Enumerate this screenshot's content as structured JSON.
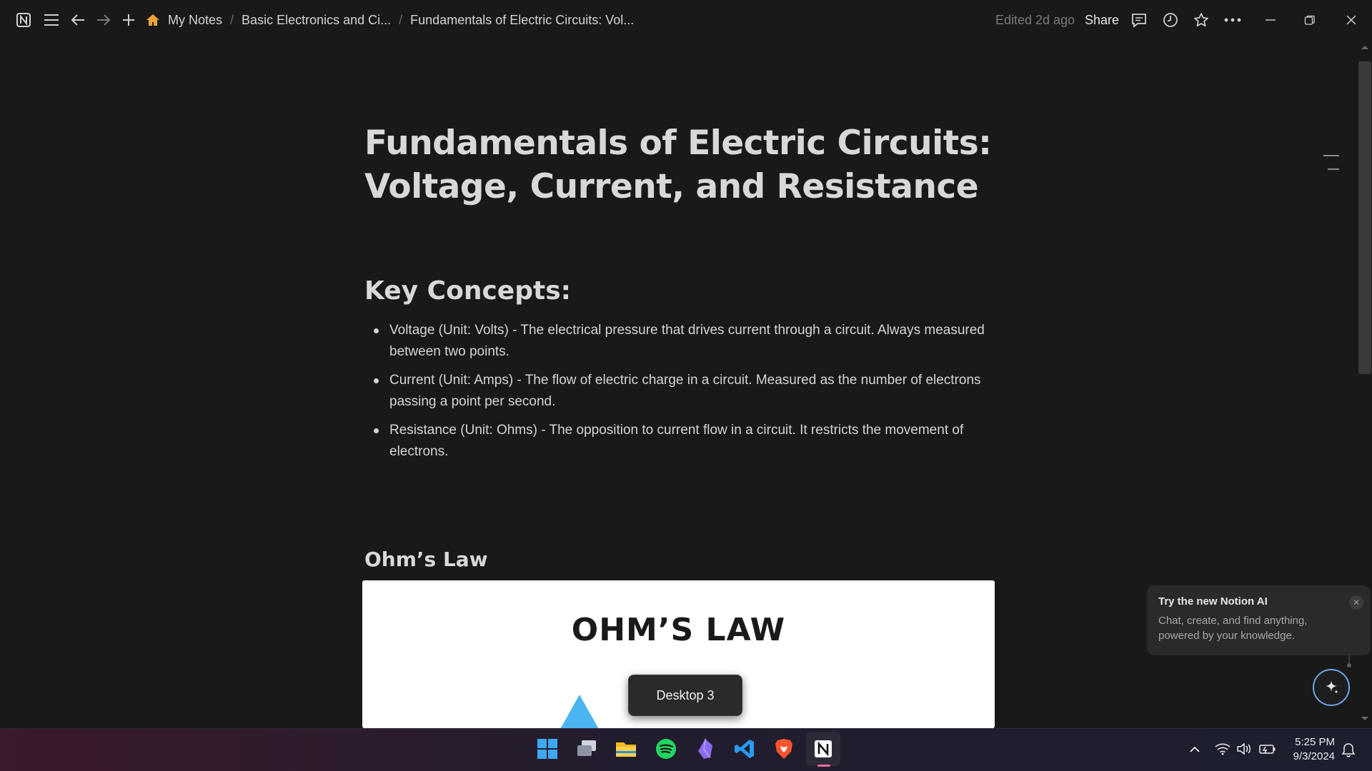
{
  "topbar": {
    "breadcrumb": [
      {
        "label": "My Notes"
      },
      {
        "label": "Basic Electronics and Ci..."
      },
      {
        "label": "Fundamentals of Electric Circuits: Vol..."
      }
    ],
    "edited": "Edited 2d ago",
    "share": "Share"
  },
  "page": {
    "title_line1": "Fundamentals of Electric Circuits:",
    "title_line2": "Voltage, Current, and Resistance",
    "key_concepts_heading": "Key Concepts:",
    "concepts": [
      "Voltage (Unit: Volts) - The electrical pressure that drives current through a circuit. Always measured between two points.",
      "Current (Unit: Amps) - The flow of electric charge in a circuit. Measured as the number of electrons passing a point per second.",
      "Resistance (Unit: Ohms) - The opposition to current flow in a circuit. It restricts the movement of electrons."
    ],
    "ohms_heading": "Ohm’s Law",
    "image_title": "OHM’S LAW"
  },
  "toast": {
    "label": "Desktop 3"
  },
  "ai_card": {
    "title": "Try the new Notion AI",
    "description": "Chat, create, and find anything, powered by your knowledge."
  },
  "taskbar": {
    "apps": [
      "windows-start",
      "task-view",
      "file-explorer",
      "spotify",
      "obsidian",
      "vscode",
      "brave",
      "notion"
    ],
    "time": "5:25 PM",
    "date": "9/3/2024"
  },
  "colors": {
    "background": "#191919",
    "accent_blue": "#4ab5f0",
    "home_icon": "#f0a23a",
    "spotify": "#1ed760",
    "vscode": "#2b9af3",
    "brave": "#fb542b"
  }
}
